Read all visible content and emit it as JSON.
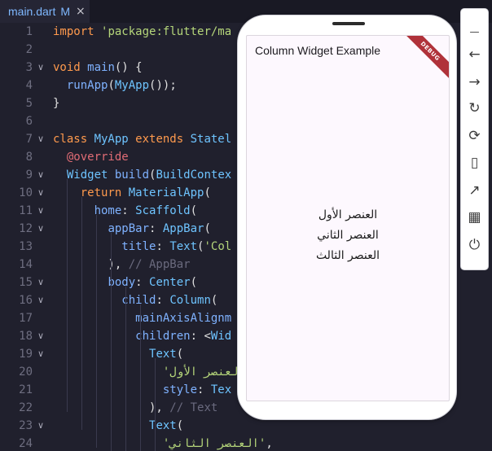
{
  "tab": {
    "filename": "main.dart",
    "status": "M",
    "close_glyph": "×"
  },
  "lines": [
    {
      "n": "1",
      "fold": "",
      "tokens": [
        [
          "k",
          "import "
        ],
        [
          "s",
          "'package:flutter/ma"
        ]
      ]
    },
    {
      "n": "2",
      "fold": "",
      "tokens": []
    },
    {
      "n": "3",
      "fold": "v",
      "tokens": [
        [
          "k",
          "void "
        ],
        [
          "f",
          "main"
        ],
        [
          "p",
          "() {"
        ]
      ]
    },
    {
      "n": "4",
      "fold": "",
      "tokens": [
        [
          "p",
          "  "
        ],
        [
          "f",
          "runApp"
        ],
        [
          "p",
          "("
        ],
        [
          "n",
          "MyApp"
        ],
        [
          "p",
          "());"
        ]
      ]
    },
    {
      "n": "5",
      "fold": "",
      "tokens": [
        [
          "p",
          "}"
        ]
      ]
    },
    {
      "n": "6",
      "fold": "",
      "tokens": []
    },
    {
      "n": "7",
      "fold": "v",
      "tokens": [
        [
          "k",
          "class "
        ],
        [
          "n",
          "MyApp "
        ],
        [
          "k",
          "extends "
        ],
        [
          "n",
          "Statel"
        ]
      ]
    },
    {
      "n": "8",
      "fold": "",
      "tokens": [
        [
          "p",
          "  "
        ],
        [
          "a",
          "@override"
        ]
      ]
    },
    {
      "n": "9",
      "fold": "v",
      "tokens": [
        [
          "p",
          "  "
        ],
        [
          "n",
          "Widget "
        ],
        [
          "f",
          "build"
        ],
        [
          "p",
          "("
        ],
        [
          "n",
          "BuildContex"
        ]
      ]
    },
    {
      "n": "10",
      "fold": "v",
      "tokens": [
        [
          "p",
          "    "
        ],
        [
          "k",
          "return "
        ],
        [
          "n",
          "MaterialApp"
        ],
        [
          "p",
          "("
        ]
      ]
    },
    {
      "n": "11",
      "fold": "v",
      "tokens": [
        [
          "p",
          "      "
        ],
        [
          "f",
          "home"
        ],
        [
          "p",
          ": "
        ],
        [
          "n",
          "Scaffold"
        ],
        [
          "p",
          "("
        ]
      ]
    },
    {
      "n": "12",
      "fold": "v",
      "tokens": [
        [
          "p",
          "        "
        ],
        [
          "f",
          "appBar"
        ],
        [
          "p",
          ": "
        ],
        [
          "n",
          "AppBar"
        ],
        [
          "p",
          "("
        ]
      ]
    },
    {
      "n": "13",
      "fold": "",
      "tokens": [
        [
          "p",
          "          "
        ],
        [
          "f",
          "title"
        ],
        [
          "p",
          ": "
        ],
        [
          "n",
          "Text"
        ],
        [
          "p",
          "("
        ],
        [
          "s",
          "'Col"
        ]
      ]
    },
    {
      "n": "14",
      "fold": "",
      "tokens": [
        [
          "p",
          "        ), "
        ],
        [
          "c",
          "// AppBar"
        ]
      ]
    },
    {
      "n": "15",
      "fold": "v",
      "tokens": [
        [
          "p",
          "        "
        ],
        [
          "f",
          "body"
        ],
        [
          "p",
          ": "
        ],
        [
          "n",
          "Center"
        ],
        [
          "p",
          "("
        ]
      ]
    },
    {
      "n": "16",
      "fold": "v",
      "tokens": [
        [
          "p",
          "          "
        ],
        [
          "f",
          "child"
        ],
        [
          "p",
          ": "
        ],
        [
          "n",
          "Column"
        ],
        [
          "p",
          "("
        ]
      ]
    },
    {
      "n": "17",
      "fold": "",
      "tokens": [
        [
          "p",
          "            "
        ],
        [
          "f",
          "mainAxisAlignm"
        ]
      ]
    },
    {
      "n": "18",
      "fold": "v",
      "tokens": [
        [
          "p",
          "            "
        ],
        [
          "f",
          "children"
        ],
        [
          "p",
          ": <"
        ],
        [
          "n",
          "Wid"
        ]
      ]
    },
    {
      "n": "19",
      "fold": "v",
      "tokens": [
        [
          "p",
          "              "
        ],
        [
          "n",
          "Text"
        ],
        [
          "p",
          "("
        ]
      ]
    },
    {
      "n": "20",
      "fold": "",
      "tokens": [
        [
          "p",
          "                "
        ],
        [
          "s",
          "'العنصر الأول"
        ]
      ]
    },
    {
      "n": "21",
      "fold": "",
      "tokens": [
        [
          "p",
          "                "
        ],
        [
          "f",
          "style"
        ],
        [
          "p",
          ": "
        ],
        [
          "n",
          "Tex"
        ]
      ]
    },
    {
      "n": "22",
      "fold": "",
      "tokens": [
        [
          "p",
          "              ), "
        ],
        [
          "c",
          "// Text"
        ]
      ]
    },
    {
      "n": "23",
      "fold": "v",
      "tokens": [
        [
          "p",
          "              "
        ],
        [
          "n",
          "Text"
        ],
        [
          "p",
          "("
        ]
      ]
    },
    {
      "n": "24",
      "fold": "",
      "tokens": [
        [
          "p",
          "                "
        ],
        [
          "s",
          "'العنصر الثاني'"
        ],
        [
          "p",
          ","
        ]
      ]
    }
  ],
  "phone": {
    "appbar_title": "Column Widget Example",
    "debug_label": "DEBUG",
    "items": [
      "العنصر الأول",
      "العنصر الثاني",
      "العنصر الثالث"
    ]
  },
  "toolbar": {
    "buttons": [
      {
        "name": "minimize-icon",
        "glyph": "—"
      },
      {
        "name": "back-icon",
        "glyph": "←"
      },
      {
        "name": "forward-icon",
        "glyph": "→"
      },
      {
        "name": "rotate-icon",
        "glyph": "↻"
      },
      {
        "name": "rotate-device-icon",
        "glyph": "⟳"
      },
      {
        "name": "phone-icon",
        "glyph": "▯"
      },
      {
        "name": "open-external-icon",
        "glyph": "↗"
      },
      {
        "name": "qr-code-icon",
        "glyph": "▦"
      },
      {
        "name": "power-icon",
        "glyph": "⏻"
      }
    ]
  }
}
